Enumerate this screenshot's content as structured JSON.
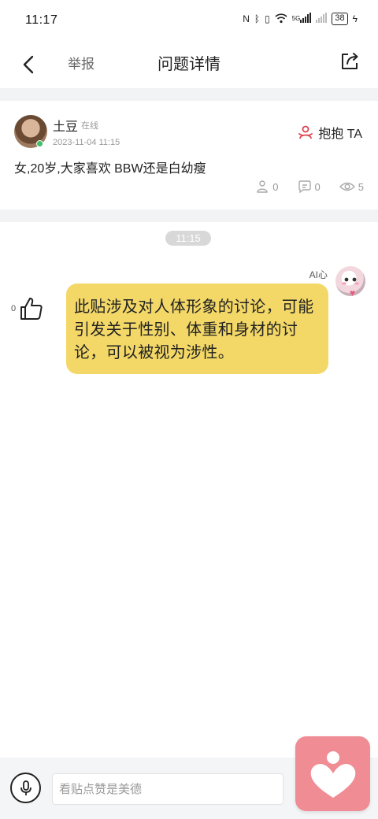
{
  "status_bar": {
    "time": "11:17",
    "icons": [
      "nfc-icon",
      "bluetooth-icon",
      "vibrate-icon",
      "wifi-icon",
      "signal-5g-icon",
      "signal-icon"
    ],
    "network": "5G",
    "battery": "38"
  },
  "nav": {
    "report_label": "举报",
    "title": "问题详情"
  },
  "post": {
    "author": "土豆",
    "online": "在线",
    "time": "2023-11-04 11:15",
    "hug_label": "抱抱 TA",
    "content": "女,20岁,大家喜欢 BBW还是白幼瘦",
    "stats": {
      "hugs": "0",
      "comments": "0",
      "views": "5"
    }
  },
  "chat": {
    "time": "11:15",
    "ai_name": "AI心",
    "message": "此贴涉及对人体形象的讨论，可能引发关于性别、体重和身材的讨论，可以被视为涉性。",
    "likes": "0"
  },
  "input": {
    "placeholder": "看贴点赞是美德"
  },
  "colors": {
    "bubble": "#f3d868",
    "heart_button": "#f08c94",
    "hug_icon": "#e0424f",
    "background_band": "#f2f3f5"
  }
}
